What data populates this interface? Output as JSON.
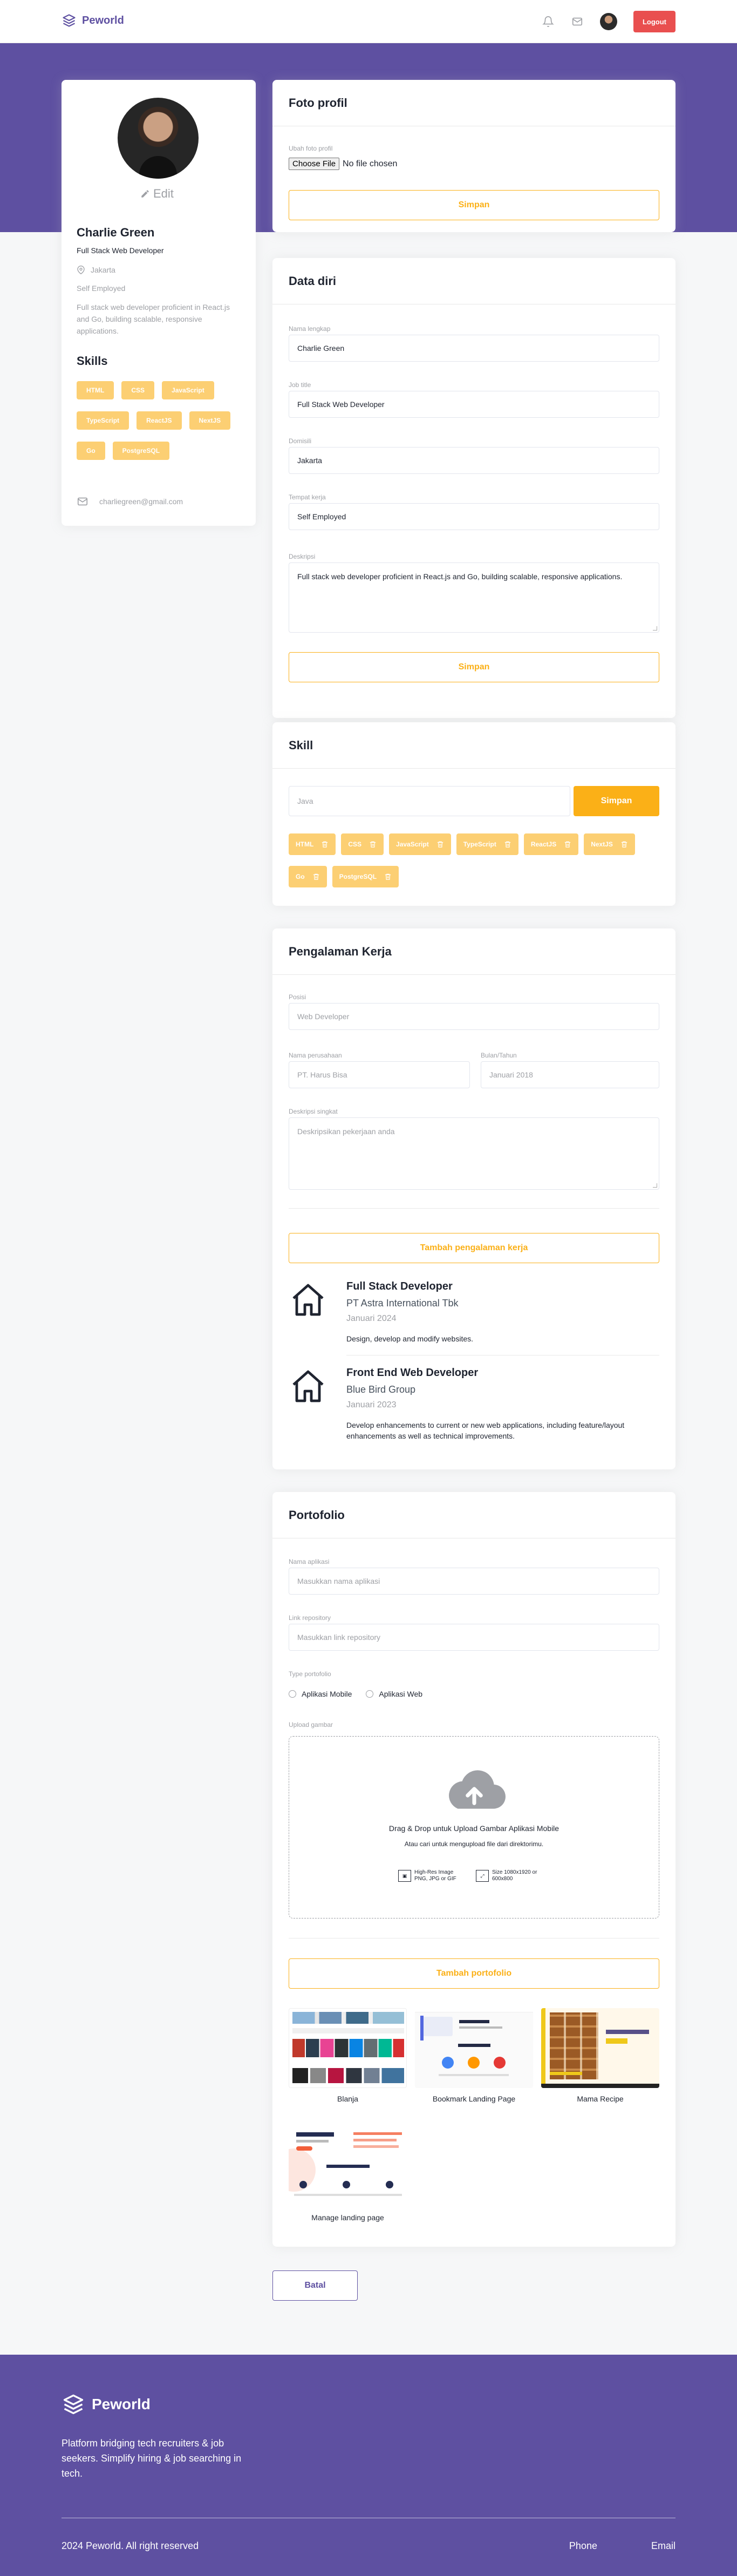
{
  "nav": {
    "brand": "Peworld",
    "logout_label": "Logout",
    "icons": [
      "bell-icon",
      "mail-icon",
      "avatar"
    ]
  },
  "profile": {
    "edit_label": "Edit",
    "name": "Charlie Green",
    "job_title": "Full Stack Web Developer",
    "location": "Jakarta",
    "workplace": "Self Employed",
    "description": "Full stack web developer proficient in React.js and Go, building scalable, responsive applications.",
    "skills_heading": "Skills",
    "skills": [
      "HTML",
      "CSS",
      "JavaScript",
      "TypeScript",
      "ReactJS",
      "NextJS",
      "Go",
      "PostgreSQL"
    ],
    "email": "charliegreen@gmail.com"
  },
  "photo_card": {
    "title": "Foto profil",
    "file_label": "Ubah foto profil",
    "file_button": "Choose File",
    "file_status": "No file chosen",
    "save_label": "Simpan"
  },
  "data_diri": {
    "title": "Data diri",
    "fields": [
      {
        "label": "Nama lengkap",
        "value": "Charlie Green"
      },
      {
        "label": "Job title",
        "value": "Full Stack Web Developer"
      },
      {
        "label": "Domisili",
        "value": "Jakarta"
      },
      {
        "label": "Tempat kerja",
        "value": "Self Employed"
      }
    ],
    "description_label": "Deskripsi",
    "description_value": "Full stack web developer proficient in React.js and Go, building scalable, responsive applications.",
    "save_label": "Simpan"
  },
  "skill_card": {
    "title": "Skill",
    "input_value": "Java",
    "save_label": "Simpan",
    "skills": [
      "HTML",
      "CSS",
      "JavaScript",
      "TypeScript",
      "ReactJS",
      "NextJS",
      "Go",
      "PostgreSQL"
    ]
  },
  "experience": {
    "title": "Pengalaman Kerja",
    "position_label": "Posisi",
    "position_placeholder": "Web Developer",
    "company_label": "Nama perusahaan",
    "company_placeholder": "PT. Harus Bisa",
    "date_label": "Bulan/Tahun",
    "date_placeholder": "Januari 2018",
    "desc_label": "Deskripsi singkat",
    "desc_placeholder": "Deskripsikan pekerjaan anda",
    "add_label": "Tambah pengalaman kerja",
    "items": [
      {
        "title": "Full Stack Developer",
        "company": "PT Astra International Tbk",
        "date": "Januari 2024",
        "description": "Design, develop and modify websites."
      },
      {
        "title": "Front End Web Developer",
        "company": "Blue Bird Group",
        "date": "Januari 2023",
        "description": "Develop enhancements to current or new web applications, including feature/layout enhancements as well as technical improvements."
      }
    ]
  },
  "portfolio": {
    "title": "Portofolio",
    "app_name_label": "Nama aplikasi",
    "app_name_placeholder": "Masukkan nama aplikasi",
    "repo_label": "Link repository",
    "repo_placeholder": "Masukkan link repository",
    "type_label": "Type portofolio",
    "type_options": [
      "Aplikasi Mobile",
      "Aplikasi Web"
    ],
    "upload_label": "Upload gambar",
    "upload_title": "Drag & Drop untuk Upload Gambar Aplikasi Mobile",
    "upload_subtitle": "Atau cari untuk mengupload file dari direktorimu.",
    "upload_meta_1": "High-Res Image PNG, JPG or GIF",
    "upload_meta_2": "Size 1080x1920 or 600x800",
    "add_label": "Tambah portofolio",
    "items": [
      {
        "name": "Blanja"
      },
      {
        "name": "Bookmark Landing Page"
      },
      {
        "name": "Mama Recipe"
      },
      {
        "name": "Manage landing page"
      }
    ]
  },
  "cancel_label": "Batal",
  "footer": {
    "brand": "Peworld",
    "description": "Platform bridging tech recruiters & job seekers. Simplify hiring & job searching in tech.",
    "copyright": "2024 Peworld. All right reserved",
    "links": [
      "Phone",
      "Email"
    ]
  },
  "colors": {
    "primary": "#5e50a1",
    "accent": "#fbb017",
    "danger": "#e94f4f"
  }
}
